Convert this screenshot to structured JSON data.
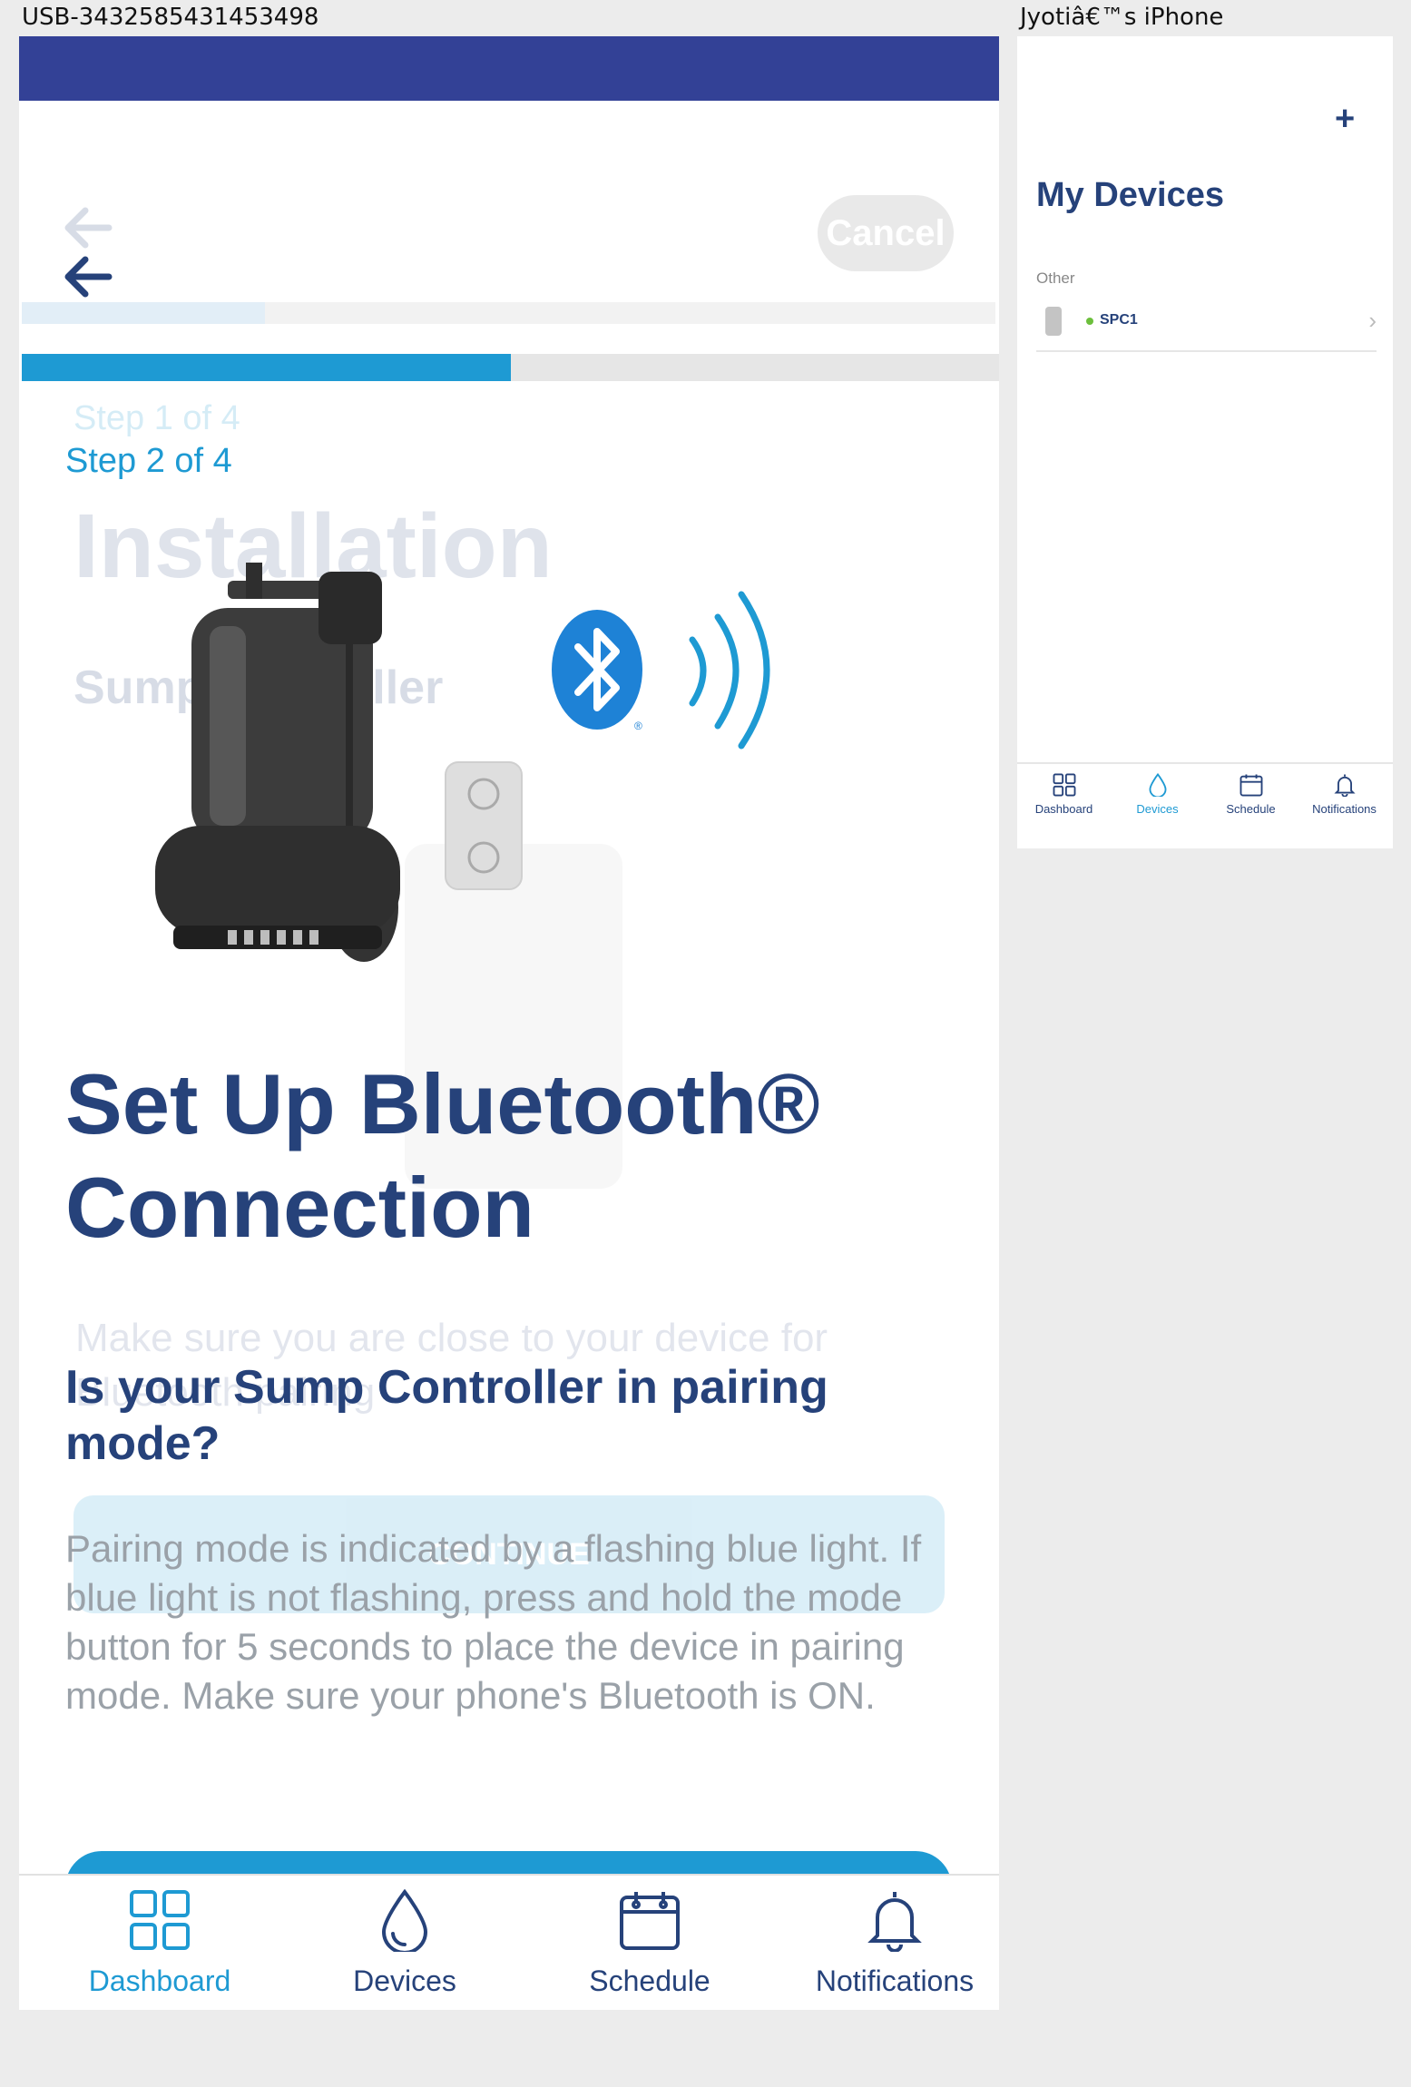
{
  "window": {
    "left_label": "USB-3432585431453498",
    "right_label": "Jyotiâ€™s iPhone"
  },
  "colors": {
    "brand_navy": "#26427a",
    "accent_blue": "#1e9ad3",
    "status_bar": "#334196"
  },
  "setup": {
    "ghost": {
      "step_label": "Step 1 of 4",
      "title": "Installation",
      "subtitle": "Sump Controller",
      "instruction": "Make sure you are close to your device for Bluetooth pairing",
      "cancel_label": "Cancel",
      "continue_label": "CONTINUE",
      "progress_fraction": 0.25
    },
    "back_icon": "arrow-left-icon",
    "progress_fraction": 0.5,
    "step_label": "Step 2 of 4",
    "title": "Set Up Bluetooth® Connection",
    "question": "Is your Sump Controller in pairing mode?",
    "body": "Pairing mode is indicated by a flashing blue light. If blue light is not flashing, press and hold the mode button for 5 seconds to place the device in pairing mode. Make sure your phone's Bluetooth is ON."
  },
  "tabbar": {
    "tabs": [
      {
        "label": "Dashboard",
        "icon": "grid-icon",
        "active": true
      },
      {
        "label": "Devices",
        "icon": "drop-icon",
        "active": false
      },
      {
        "label": "Schedule",
        "icon": "calendar-icon",
        "active": false
      },
      {
        "label": "Notifications",
        "icon": "bell-icon",
        "active": false
      }
    ]
  },
  "devices_screen": {
    "add_label": "+",
    "title": "My Devices",
    "section": "Other",
    "device": {
      "name": "SPC1",
      "status_color": "#6cbf3c"
    },
    "tabs": [
      {
        "label": "Dashboard",
        "icon": "grid-icon",
        "active": false
      },
      {
        "label": "Devices",
        "icon": "drop-icon",
        "active": true
      },
      {
        "label": "Schedule",
        "icon": "calendar-icon",
        "active": false
      },
      {
        "label": "Notifications",
        "icon": "bell-icon",
        "active": false
      }
    ]
  }
}
